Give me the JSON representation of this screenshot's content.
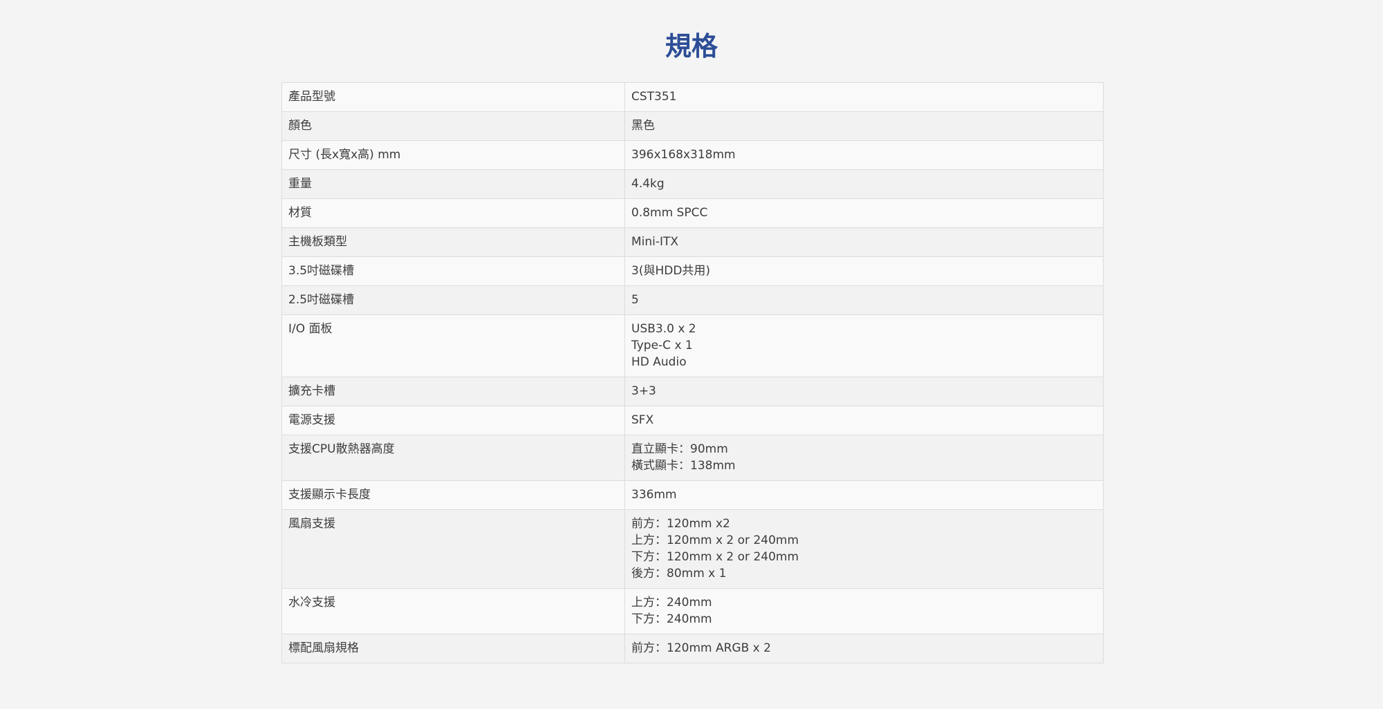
{
  "title": "規格",
  "specs": [
    {
      "label": "產品型號",
      "values": [
        "CST351"
      ]
    },
    {
      "label": "顏色",
      "values": [
        "黑色"
      ]
    },
    {
      "label": "尺寸 (長x寬x高) mm",
      "values": [
        "396x168x318mm"
      ]
    },
    {
      "label": "重量",
      "values": [
        "4.4kg"
      ]
    },
    {
      "label": "材質",
      "values": [
        "0.8mm SPCC"
      ]
    },
    {
      "label": "主機板類型",
      "values": [
        "Mini-ITX"
      ]
    },
    {
      "label": "3.5吋磁碟槽",
      "values": [
        "3(與HDD共用)"
      ]
    },
    {
      "label": "2.5吋磁碟槽",
      "values": [
        "5"
      ]
    },
    {
      "label": "I/O 面板",
      "values": [
        "USB3.0 x 2",
        "Type-C x 1",
        "HD Audio"
      ]
    },
    {
      "label": "擴充卡槽",
      "values": [
        "3+3"
      ]
    },
    {
      "label": "電源支援",
      "values": [
        "SFX"
      ]
    },
    {
      "label": "支援CPU散熱器高度",
      "values": [
        "直立顯卡：90mm",
        "橫式顯卡：138mm"
      ]
    },
    {
      "label": "支援顯示卡長度",
      "values": [
        "336mm"
      ]
    },
    {
      "label": "風扇支援",
      "values": [
        "前方：120mm x2",
        "上方：120mm x 2 or 240mm",
        "下方：120mm x 2 or 240mm",
        "後方：80mm x 1"
      ]
    },
    {
      "label": "水冷支援",
      "values": [
        "上方：240mm",
        "下方：240mm"
      ]
    },
    {
      "label": "標配風扇規格",
      "values": [
        "前方：120mm ARGB x 2"
      ]
    }
  ]
}
